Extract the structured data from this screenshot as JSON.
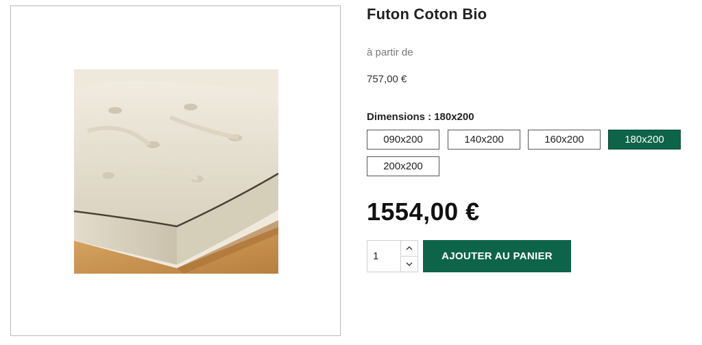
{
  "product": {
    "title": "Futon Coton Bio",
    "from_label": "à partir de",
    "from_price": "757,00 €",
    "image_icon": "futon-mattress-image"
  },
  "dimensions": {
    "label": "Dimensions :",
    "selected": "180x200",
    "options": [
      "090x200",
      "140x200",
      "160x200",
      "180x200",
      "200x200"
    ]
  },
  "price": "1554,00 €",
  "quantity": {
    "value": "1",
    "up_icon": "chevron-up-icon",
    "down_icon": "chevron-down-icon"
  },
  "cart": {
    "add_label": "AJOUTER AU PANIER"
  },
  "colors": {
    "accent": "#0e6448",
    "border": "#555555",
    "text": "#222222",
    "muted": "#777777"
  }
}
